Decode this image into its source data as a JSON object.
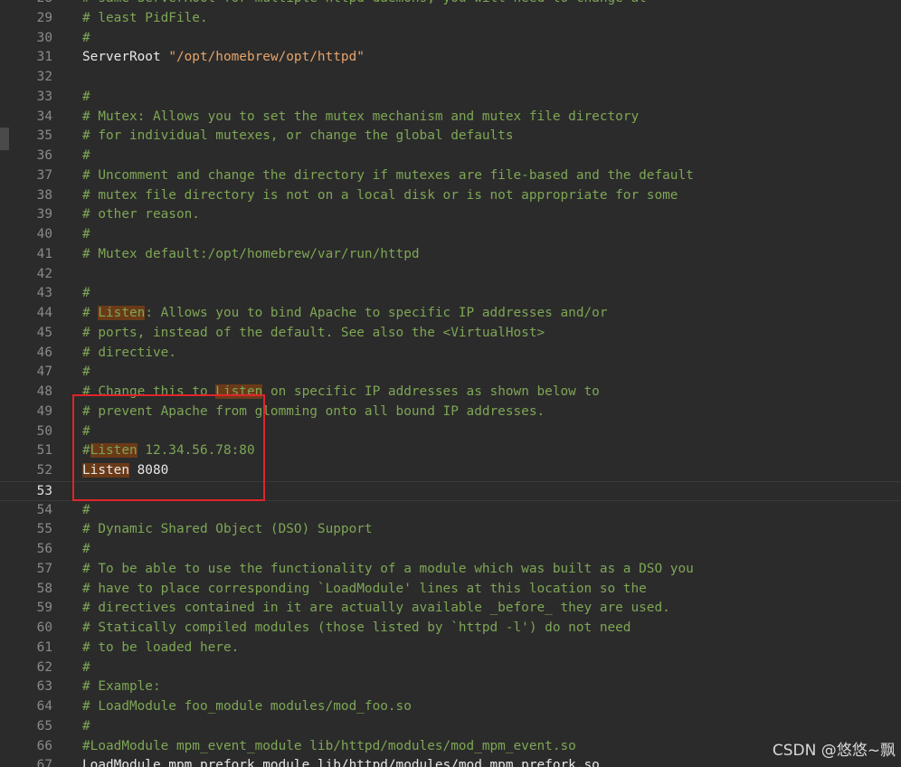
{
  "editor": {
    "current_line": "53",
    "lines": [
      {
        "num": "28",
        "parts": [
          {
            "t": "# same ServerRoot for multiple httpd daemons, you will need to change at",
            "c": "cmt"
          }
        ]
      },
      {
        "num": "29",
        "parts": [
          {
            "t": "# least PidFile.",
            "c": "cmt"
          }
        ]
      },
      {
        "num": "30",
        "parts": [
          {
            "t": "#",
            "c": "cmt"
          }
        ]
      },
      {
        "num": "31",
        "parts": [
          {
            "t": "ServerRoot ",
            "c": "kw"
          },
          {
            "t": "\"/opt/homebrew/opt/httpd\"",
            "c": "str"
          }
        ]
      },
      {
        "num": "32",
        "parts": []
      },
      {
        "num": "33",
        "parts": [
          {
            "t": "#",
            "c": "cmt"
          }
        ]
      },
      {
        "num": "34",
        "parts": [
          {
            "t": "# Mutex: Allows you to set the mutex mechanism and mutex file directory",
            "c": "cmt"
          }
        ]
      },
      {
        "num": "35",
        "parts": [
          {
            "t": "# for individual mutexes, or change the global defaults",
            "c": "cmt"
          }
        ]
      },
      {
        "num": "36",
        "parts": [
          {
            "t": "#",
            "c": "cmt"
          }
        ]
      },
      {
        "num": "37",
        "parts": [
          {
            "t": "# Uncomment and change the directory if mutexes are file-based and the default",
            "c": "cmt"
          }
        ]
      },
      {
        "num": "38",
        "parts": [
          {
            "t": "# mutex file directory is not on a local disk or is not appropriate for some",
            "c": "cmt"
          }
        ]
      },
      {
        "num": "39",
        "parts": [
          {
            "t": "# other reason.",
            "c": "cmt"
          }
        ]
      },
      {
        "num": "40",
        "parts": [
          {
            "t": "#",
            "c": "cmt"
          }
        ]
      },
      {
        "num": "41",
        "parts": [
          {
            "t": "# Mutex default:/opt/homebrew/var/run/httpd",
            "c": "cmt"
          }
        ]
      },
      {
        "num": "42",
        "parts": []
      },
      {
        "num": "43",
        "parts": [
          {
            "t": "#",
            "c": "cmt"
          }
        ]
      },
      {
        "num": "44",
        "parts": [
          {
            "t": "# ",
            "c": "cmt"
          },
          {
            "t": "Listen",
            "c": "cmt hl"
          },
          {
            "t": ": Allows you to bind Apache to specific IP addresses and/or",
            "c": "cmt"
          }
        ]
      },
      {
        "num": "45",
        "parts": [
          {
            "t": "# ports, instead of the default. See also the <VirtualHost>",
            "c": "cmt"
          }
        ]
      },
      {
        "num": "46",
        "parts": [
          {
            "t": "# directive.",
            "c": "cmt"
          }
        ]
      },
      {
        "num": "47",
        "parts": [
          {
            "t": "#",
            "c": "cmt"
          }
        ]
      },
      {
        "num": "48",
        "parts": [
          {
            "t": "# Change this to ",
            "c": "cmt"
          },
          {
            "t": "Listen",
            "c": "cmt hl"
          },
          {
            "t": " on specific IP addresses as shown below to",
            "c": "cmt"
          }
        ]
      },
      {
        "num": "49",
        "parts": [
          {
            "t": "# prevent Apache from glomming onto all bound IP addresses.",
            "c": "cmt"
          }
        ]
      },
      {
        "num": "50",
        "parts": [
          {
            "t": "#",
            "c": "cmt"
          }
        ]
      },
      {
        "num": "51",
        "parts": [
          {
            "t": "#",
            "c": "cmt"
          },
          {
            "t": "Listen",
            "c": "cmt hl"
          },
          {
            "t": " 12.34.56.78:80",
            "c": "cmt"
          }
        ]
      },
      {
        "num": "52",
        "parts": [
          {
            "t": "Listen",
            "c": "kw hl"
          },
          {
            "t": " 8080",
            "c": "plain"
          }
        ]
      },
      {
        "num": "53",
        "parts": []
      },
      {
        "num": "54",
        "parts": [
          {
            "t": "#",
            "c": "cmt"
          }
        ]
      },
      {
        "num": "55",
        "parts": [
          {
            "t": "# Dynamic Shared Object (DSO) Support",
            "c": "cmt"
          }
        ]
      },
      {
        "num": "56",
        "parts": [
          {
            "t": "#",
            "c": "cmt"
          }
        ]
      },
      {
        "num": "57",
        "parts": [
          {
            "t": "# To be able to use the functionality of a module which was built as a DSO you",
            "c": "cmt"
          }
        ]
      },
      {
        "num": "58",
        "parts": [
          {
            "t": "# have to place corresponding `LoadModule' lines at this location so the",
            "c": "cmt"
          }
        ]
      },
      {
        "num": "59",
        "parts": [
          {
            "t": "# directives contained in it are actually available _before_ they are used.",
            "c": "cmt"
          }
        ]
      },
      {
        "num": "60",
        "parts": [
          {
            "t": "# Statically compiled modules (those listed by `httpd -l') do not need",
            "c": "cmt"
          }
        ]
      },
      {
        "num": "61",
        "parts": [
          {
            "t": "# to be loaded here.",
            "c": "cmt"
          }
        ]
      },
      {
        "num": "62",
        "parts": [
          {
            "t": "#",
            "c": "cmt"
          }
        ]
      },
      {
        "num": "63",
        "parts": [
          {
            "t": "# Example:",
            "c": "cmt"
          }
        ]
      },
      {
        "num": "64",
        "parts": [
          {
            "t": "# LoadModule foo_module modules/mod_foo.so",
            "c": "cmt"
          }
        ]
      },
      {
        "num": "65",
        "parts": [
          {
            "t": "#",
            "c": "cmt"
          }
        ]
      },
      {
        "num": "66",
        "parts": [
          {
            "t": "#LoadModule mpm_event_module lib/httpd/modules/mod_mpm_event.so",
            "c": "cmt"
          }
        ]
      },
      {
        "num": "67",
        "parts": [
          {
            "t": "LoadModule mpm_prefork_module lib/httpd/modules/mod_mpm_prefork.so",
            "c": "kw"
          }
        ]
      }
    ]
  },
  "watermark": "CSDN @悠悠~飘",
  "colors": {
    "background": "#2b2b2b",
    "comment": "#7ea655",
    "string": "#e6a36a",
    "keyword": "#e8e8e8",
    "highlight": "#6a3a18",
    "annotation_box": "#e0242a"
  }
}
